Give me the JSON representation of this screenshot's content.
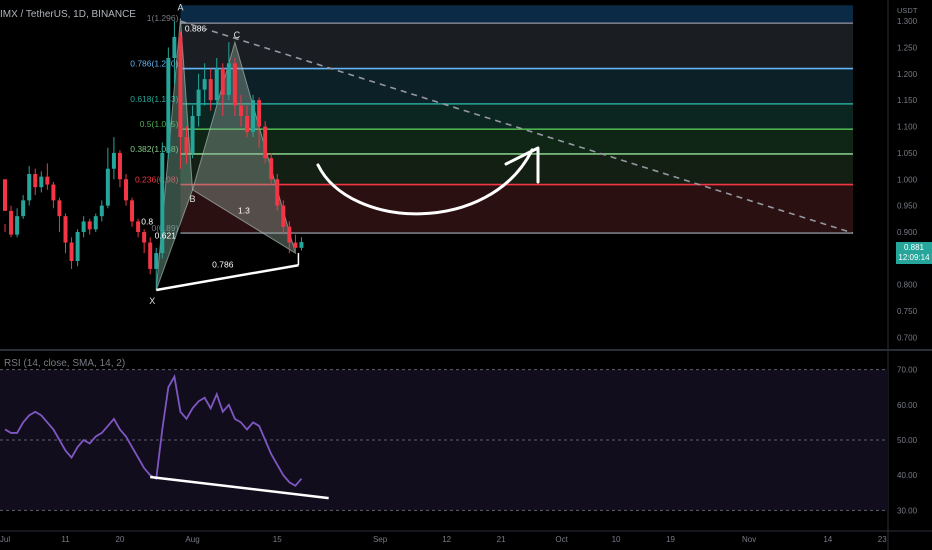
{
  "header": {
    "symbol": "IMX / TetherUS, 1D, BINANCE"
  },
  "price_axis": {
    "currency": "USDT",
    "ticks": [
      {
        "label": "1.300",
        "v": 1.3
      },
      {
        "label": "1.250",
        "v": 1.25
      },
      {
        "label": "1.200",
        "v": 1.2
      },
      {
        "label": "1.150",
        "v": 1.15
      },
      {
        "label": "1.100",
        "v": 1.1
      },
      {
        "label": "1.050",
        "v": 1.05
      },
      {
        "label": "1.000",
        "v": 1.0
      },
      {
        "label": "0.950",
        "v": 0.95
      },
      {
        "label": "0.900",
        "v": 0.9
      },
      {
        "label": "0.850",
        "v": 0.85
      },
      {
        "label": "0.800",
        "v": 0.8
      },
      {
        "label": "0.750",
        "v": 0.75
      },
      {
        "label": "0.700",
        "v": 0.7
      }
    ],
    "last_price": "0.881",
    "countdown": "12:09:14"
  },
  "time_axis": {
    "ticks": [
      {
        "label": "Jul",
        "d": 0
      },
      {
        "label": "11",
        "d": 10
      },
      {
        "label": "20",
        "d": 19
      },
      {
        "label": "Aug",
        "d": 31
      },
      {
        "label": "15",
        "d": 45
      },
      {
        "label": "Sep",
        "d": 62
      },
      {
        "label": "12",
        "d": 73
      },
      {
        "label": "21",
        "d": 82
      },
      {
        "label": "Oct",
        "d": 92
      },
      {
        "label": "10",
        "d": 101
      },
      {
        "label": "19",
        "d": 110
      },
      {
        "label": "Nov",
        "d": 123
      },
      {
        "label": "14",
        "d": 136
      },
      {
        "label": "23",
        "d": 145
      }
    ]
  },
  "fib": {
    "levels": [
      {
        "label": "1(1.296)",
        "price": 1.296,
        "color": "#787b86"
      },
      {
        "label": "0.786(1.210)",
        "price": 1.21,
        "color": "#64b5f6"
      },
      {
        "label": "0.618(1.143)",
        "price": 1.143,
        "color": "#26a69a"
      },
      {
        "label": "0.5(1.095)",
        "price": 1.095,
        "color": "#4caf50"
      },
      {
        "label": "0.382(1.048)",
        "price": 1.048,
        "color": "#81c784"
      },
      {
        "label": "0.236(0.98)",
        "price": 0.99,
        "color": "#f23645"
      },
      {
        "label": "0(0.89)",
        "price": 0.898,
        "color": "#787b86"
      }
    ],
    "bands": [
      {
        "from": 1.296,
        "to": 1.33,
        "color": "#0b2a45"
      },
      {
        "from": 1.21,
        "to": 1.296,
        "color": "#1a1d22"
      },
      {
        "from": 1.143,
        "to": 1.21,
        "color": "#0c2027"
      },
      {
        "from": 1.095,
        "to": 1.143,
        "color": "#0b2521"
      },
      {
        "from": 1.048,
        "to": 1.095,
        "color": "#0f2616"
      },
      {
        "from": 0.99,
        "to": 1.048,
        "color": "#141f14"
      },
      {
        "from": 0.898,
        "to": 0.99,
        "color": "#2a1010"
      }
    ]
  },
  "pattern": {
    "points": [
      {
        "label": "X",
        "d": 25,
        "p": 0.79
      },
      {
        "label": "A",
        "d": 29,
        "p": 1.305
      },
      {
        "label": "B",
        "d": 31,
        "p": 0.98
      },
      {
        "label": "C",
        "d": 38,
        "p": 1.26
      },
      {
        "label": "D",
        "d": 48,
        "p": 0.86
      }
    ],
    "ratios": [
      {
        "text": "0.886",
        "d": 31.5,
        "p": 1.28
      },
      {
        "text": "0.621",
        "d": 26.5,
        "p": 0.888
      },
      {
        "text": "1.3",
        "d": 39.5,
        "p": 0.935
      },
      {
        "text": "0.786",
        "d": 36,
        "p": 0.833
      },
      {
        "text": "0.8",
        "d": 23.5,
        "p": 0.914
      }
    ]
  },
  "rsi": {
    "title": "RSI (14, close, SMA, 14, 2)",
    "ticks": [
      {
        "label": "70.00",
        "v": 70
      },
      {
        "label": "60.00",
        "v": 60
      },
      {
        "label": "50.00",
        "v": 50
      },
      {
        "label": "40.00",
        "v": 40
      },
      {
        "label": "30.00",
        "v": 30
      }
    ]
  },
  "colors": {
    "up": "#26a69a",
    "down": "#f23645",
    "rsi": "#7e57c2",
    "white": "#ffffff"
  },
  "chart_data": {
    "type": "line",
    "title": "IMX / TetherUS, 1D, BINANCE",
    "candles": [
      [
        1.0,
        0.94,
        0.915,
        0.9
      ],
      [
        0.94,
        0.895,
        0.95,
        0.89
      ],
      [
        0.895,
        0.93,
        0.945,
        0.89
      ],
      [
        0.93,
        0.96,
        0.97,
        0.925
      ],
      [
        0.96,
        1.01,
        1.025,
        0.95
      ],
      [
        1.01,
        0.985,
        1.02,
        0.97
      ],
      [
        0.985,
        1.005,
        1.015,
        0.975
      ],
      [
        1.005,
        0.99,
        1.03,
        0.98
      ],
      [
        0.99,
        0.96,
        0.995,
        0.945
      ],
      [
        0.96,
        0.93,
        0.965,
        0.9
      ],
      [
        0.93,
        0.88,
        0.935,
        0.86
      ],
      [
        0.88,
        0.845,
        0.89,
        0.83
      ],
      [
        0.845,
        0.9,
        0.905,
        0.835
      ],
      [
        0.9,
        0.92,
        0.93,
        0.89
      ],
      [
        0.92,
        0.905,
        0.925,
        0.895
      ],
      [
        0.905,
        0.93,
        0.935,
        0.9
      ],
      [
        0.93,
        0.95,
        0.96,
        0.92
      ],
      [
        0.95,
        1.02,
        1.06,
        0.945
      ],
      [
        1.02,
        1.05,
        1.08,
        1.0
      ],
      [
        1.05,
        1.0,
        1.055,
        0.985
      ],
      [
        1.0,
        0.96,
        1.01,
        0.95
      ],
      [
        0.96,
        0.92,
        0.965,
        0.91
      ],
      [
        0.92,
        0.9,
        0.925,
        0.89
      ],
      [
        0.9,
        0.88,
        0.905,
        0.86
      ],
      [
        0.88,
        0.83,
        0.89,
        0.82
      ],
      [
        0.83,
        0.86,
        0.87,
        0.79
      ],
      [
        0.86,
        1.05,
        1.07,
        0.85
      ],
      [
        1.05,
        1.23,
        1.25,
        1.04
      ],
      [
        1.23,
        1.27,
        1.3,
        1.18
      ],
      [
        1.27,
        1.08,
        1.28,
        1.02
      ],
      [
        1.08,
        1.05,
        1.1,
        1.03
      ],
      [
        1.05,
        1.12,
        1.14,
        1.04
      ],
      [
        1.12,
        1.17,
        1.2,
        1.1
      ],
      [
        1.17,
        1.19,
        1.22,
        1.14
      ],
      [
        1.19,
        1.15,
        1.21,
        1.13
      ],
      [
        1.15,
        1.21,
        1.23,
        1.14
      ],
      [
        1.21,
        1.16,
        1.22,
        1.12
      ],
      [
        1.16,
        1.22,
        1.26,
        1.15
      ],
      [
        1.22,
        1.14,
        1.23,
        1.12
      ],
      [
        1.14,
        1.12,
        1.16,
        1.1
      ],
      [
        1.12,
        1.09,
        1.14,
        1.08
      ],
      [
        1.09,
        1.15,
        1.16,
        1.08
      ],
      [
        1.15,
        1.1,
        1.155,
        1.06
      ],
      [
        1.1,
        1.04,
        1.11,
        1.03
      ],
      [
        1.04,
        1.0,
        1.05,
        0.99
      ],
      [
        1.0,
        0.95,
        1.01,
        0.94
      ],
      [
        0.95,
        0.91,
        0.96,
        0.895
      ],
      [
        0.91,
        0.88,
        0.92,
        0.86
      ],
      [
        0.88,
        0.87,
        0.895,
        0.86
      ],
      [
        0.87,
        0.881,
        0.89,
        0.865
      ]
    ],
    "rsi_values": [
      53,
      52,
      52,
      55,
      57,
      58,
      57,
      55,
      53,
      50,
      47,
      45,
      48,
      50,
      49,
      51,
      52,
      54,
      56,
      53,
      51,
      48,
      45,
      42,
      40,
      39,
      53,
      65,
      68,
      58,
      56,
      59,
      61,
      62,
      59,
      63,
      58,
      60,
      56,
      55,
      53,
      55,
      54,
      50,
      46,
      43,
      40,
      38,
      37,
      39
    ],
    "rsi_range": [
      25,
      75
    ],
    "price_range": [
      0.68,
      1.34
    ]
  }
}
